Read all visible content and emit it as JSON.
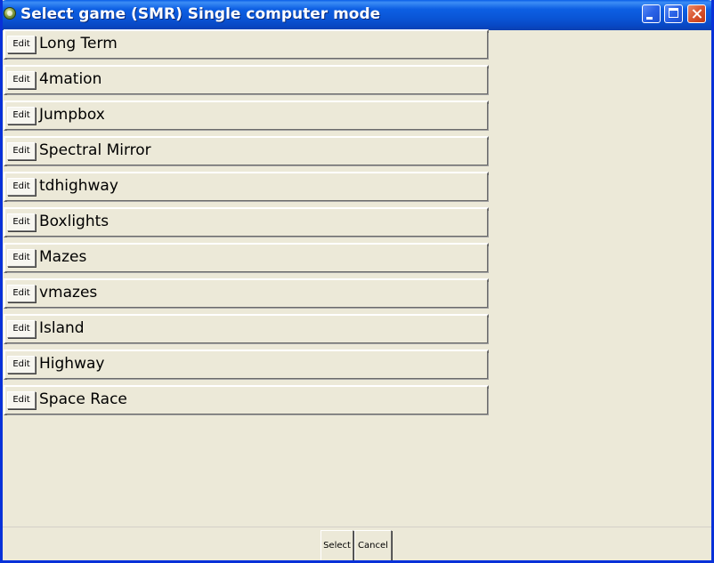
{
  "window": {
    "title": "Select game (SMR) Single computer mode"
  },
  "games": [
    {
      "edit_label": "Edit",
      "name": "Long Term"
    },
    {
      "edit_label": "Edit",
      "name": "4mation"
    },
    {
      "edit_label": "Edit",
      "name": "Jumpbox"
    },
    {
      "edit_label": "Edit",
      "name": "Spectral Mirror"
    },
    {
      "edit_label": "Edit",
      "name": "tdhighway"
    },
    {
      "edit_label": "Edit",
      "name": "Boxlights"
    },
    {
      "edit_label": "Edit",
      "name": "Mazes"
    },
    {
      "edit_label": "Edit",
      "name": "vmazes"
    },
    {
      "edit_label": "Edit",
      "name": "Island"
    },
    {
      "edit_label": "Edit",
      "name": "Highway"
    },
    {
      "edit_label": "Edit",
      "name": "Space Race"
    }
  ],
  "footer": {
    "select_label": "Select",
    "cancel_label": "Cancel"
  },
  "colors": {
    "titlebar_blue": "#0a55d6",
    "window_bg": "#ece9d8",
    "close_red": "#d9552f"
  }
}
